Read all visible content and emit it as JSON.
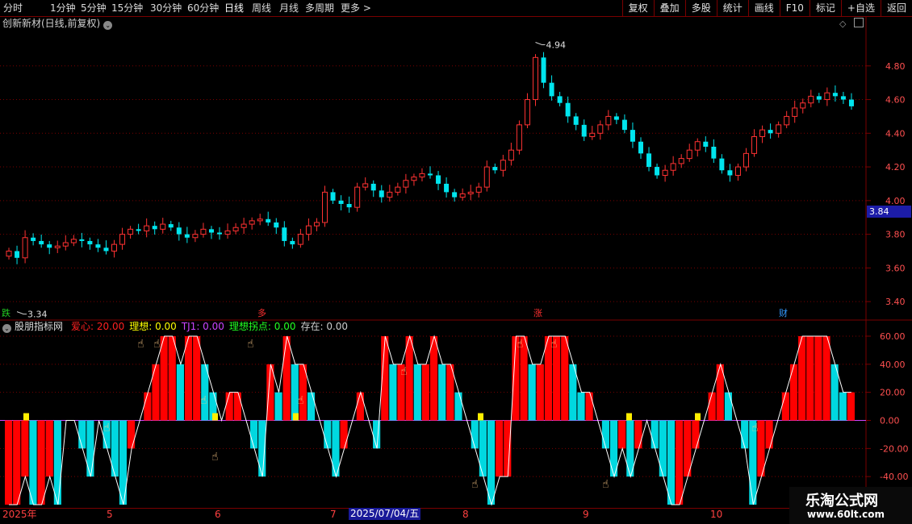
{
  "toolbar": {
    "periods": [
      "分时",
      "1分钟",
      "5分钟",
      "15分钟",
      "30分钟",
      "60分钟",
      "日线",
      "周线",
      "月线",
      "多周期",
      "更多 >"
    ],
    "active_period": "日线",
    "buttons": [
      "复权",
      "叠加",
      "多股",
      "统计",
      "画线",
      "F10",
      "标记",
      "+自选",
      "返回"
    ]
  },
  "stock": {
    "title": "创新新材(日线,前复权)"
  },
  "price_axis": {
    "labels": [
      "4.80",
      "4.60",
      "4.40",
      "4.20",
      "4.00",
      "3.80",
      "3.60",
      "3.40"
    ],
    "current_price": "3.84",
    "max_label": "4.94",
    "min_label": "3.34"
  },
  "events": [
    {
      "text": "跌",
      "color": "#22cc22"
    },
    {
      "text": "多",
      "color": "#ff3030"
    },
    {
      "text": "涨",
      "color": "#ff3030"
    },
    {
      "text": "财",
      "color": "#3399ff"
    }
  ],
  "indicator": {
    "name": "股朋指标网",
    "values": [
      {
        "label": "爱心: 20.00",
        "color": "#ff2020"
      },
      {
        "label": "理想: 0.00",
        "color": "#ffff00"
      },
      {
        "label": "TJ1: 0.00",
        "color": "#cc44ff"
      },
      {
        "label": "理想拐点: 0.00",
        "color": "#22ff22"
      },
      {
        "label": "存在: 0.00",
        "color": "#cccccc"
      }
    ],
    "axis": [
      "60.00",
      "40.00",
      "20.00",
      "0.00",
      "-20.00",
      "-40.00"
    ]
  },
  "dates": {
    "labels": [
      "2025年",
      "5",
      "6",
      "7",
      "8",
      "9",
      "10"
    ],
    "selected": "2025/07/04/五"
  },
  "watermark": {
    "line1": "乐淘公式网",
    "line2": "www.60lt.com"
  },
  "chart_data": [
    {
      "type": "candlestick",
      "title": "创新新材(日线,前复权)",
      "ylim": [
        3.3,
        5.0
      ],
      "y_ticks": [
        3.4,
        3.6,
        3.8,
        4.0,
        4.2,
        4.4,
        4.6,
        4.8
      ],
      "annotations": [
        {
          "text": "4.94",
          "value": 4.94
        },
        {
          "text": "3.34",
          "value": 3.34
        }
      ],
      "current_price": 3.84,
      "series": [
        {
          "values": [
            3.7,
            3.66,
            3.78,
            3.76,
            3.74,
            3.72,
            3.73,
            3.75,
            3.77,
            3.76,
            3.74,
            3.72,
            3.7,
            3.74,
            3.8,
            3.83,
            3.82,
            3.85,
            3.83,
            3.86,
            3.84,
            3.8,
            3.78,
            3.8,
            3.83,
            3.81,
            3.8,
            3.82,
            3.84,
            3.86,
            3.88,
            3.89,
            3.87,
            3.84,
            3.76,
            3.74,
            3.8,
            3.85,
            3.87,
            4.05,
            4.0,
            3.98,
            3.96,
            4.08,
            4.1,
            4.06,
            4.02,
            4.05,
            4.08,
            4.12,
            4.14,
            4.16,
            4.15,
            4.1,
            4.05,
            4.02,
            4.04,
            4.05,
            4.08,
            4.2,
            4.18,
            4.24,
            4.3,
            4.45,
            4.6,
            4.85,
            4.7,
            4.62,
            4.58,
            4.5,
            4.45,
            4.38,
            4.4,
            4.45,
            4.5,
            4.48,
            4.42,
            4.35,
            4.28,
            4.2,
            4.15,
            4.18,
            4.22,
            4.25,
            4.3,
            4.35,
            4.32,
            4.25,
            4.18,
            4.15,
            4.2,
            4.28,
            4.38,
            4.42,
            4.4,
            4.45,
            4.5,
            4.55,
            4.58,
            4.62,
            4.6,
            4.64,
            4.62,
            4.6,
            4.56
          ]
        }
      ]
    },
    {
      "type": "bar",
      "title": "股朋指标网",
      "ylim": [
        -60,
        60
      ],
      "y_ticks": [
        -40,
        -20,
        0,
        20,
        40,
        60
      ],
      "series": [
        {
          "name": "爱心",
          "values": [
            -60,
            -60,
            -40,
            -60,
            -60,
            -40,
            -60,
            0,
            0,
            -20,
            -40,
            0,
            -20,
            -40,
            -60,
            -20,
            0,
            20,
            40,
            60,
            60,
            40,
            60,
            60,
            40,
            20,
            0,
            20,
            20,
            0,
            -20,
            -40,
            40,
            20,
            60,
            40,
            40,
            20,
            0,
            -20,
            -40,
            -20,
            0,
            20,
            0,
            -20,
            60,
            40,
            40,
            60,
            40,
            40,
            60,
            40,
            40,
            20,
            0,
            -20,
            -40,
            -60,
            -40,
            -40,
            60,
            60,
            40,
            40,
            60,
            60,
            60,
            40,
            20,
            20,
            0,
            -20,
            -40,
            -20,
            -40,
            -20,
            0,
            -20,
            -40,
            -60,
            -60,
            -40,
            -20,
            0,
            20,
            40,
            20,
            0,
            -20,
            -60,
            -40,
            -20,
            0,
            20,
            40,
            60,
            60,
            60,
            60,
            40,
            20,
            20
          ]
        }
      ]
    }
  ]
}
